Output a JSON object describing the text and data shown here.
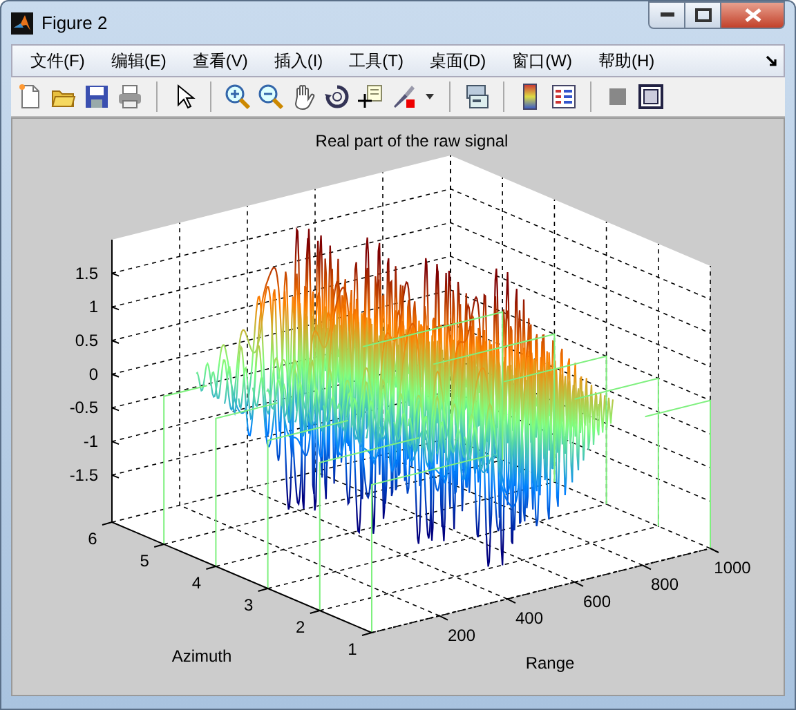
{
  "window": {
    "title": "Figure 2"
  },
  "menu": [
    "文件(F)",
    "编辑(E)",
    "查看(V)",
    "插入(I)",
    "工具(T)",
    "桌面(D)",
    "窗口(W)",
    "帮助(H)"
  ],
  "toolbar": [
    {
      "kind": "new"
    },
    {
      "kind": "open"
    },
    {
      "kind": "save"
    },
    {
      "kind": "print"
    },
    {
      "kind": "sep"
    },
    {
      "kind": "pointer"
    },
    {
      "kind": "sep"
    },
    {
      "kind": "zoomin"
    },
    {
      "kind": "zoomout"
    },
    {
      "kind": "pan"
    },
    {
      "kind": "rotate"
    },
    {
      "kind": "cursor"
    },
    {
      "kind": "brush"
    },
    {
      "kind": "caret"
    },
    {
      "kind": "sep"
    },
    {
      "kind": "link"
    },
    {
      "kind": "sep"
    },
    {
      "kind": "colorbar"
    },
    {
      "kind": "legend"
    },
    {
      "kind": "sep"
    },
    {
      "kind": "square"
    },
    {
      "kind": "frame"
    }
  ],
  "axes": {
    "title": "Real part of the raw signal",
    "xlabel": "Range",
    "ylabel": "Azimuth",
    "zticks": [
      "1.5",
      "1",
      "0.5",
      "0",
      "-0.5",
      "-1",
      "-1.5"
    ],
    "yticks": [
      "1",
      "2",
      "3",
      "4",
      "5",
      "6"
    ],
    "xticks": [
      "200",
      "400",
      "600",
      "800",
      "1000"
    ]
  }
}
